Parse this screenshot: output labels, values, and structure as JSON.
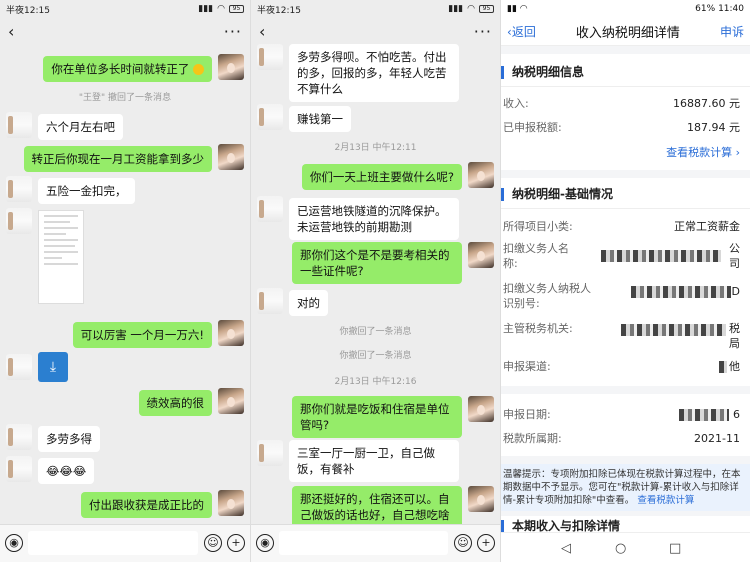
{
  "panels": {
    "left": {
      "status_time": "半夜12:15",
      "status_icons": "⏰",
      "battery": "95",
      "messages": [
        {
          "id": "m1",
          "text": "你在单位多长时间就转正了"
        },
        {
          "id": "s1",
          "text": "\"王登\" 撤回了一条消息"
        },
        {
          "id": "m2",
          "text": "六个月左右吧"
        },
        {
          "id": "m3",
          "text": "转正后你现在一月工资能拿到多少"
        },
        {
          "id": "m4",
          "text": "五险一金扣完，"
        },
        {
          "id": "m5",
          "text": "可以厉害 一个月一万六!"
        },
        {
          "id": "m6",
          "text": "绩效高的很"
        },
        {
          "id": "m7",
          "text": "多劳多得"
        },
        {
          "id": "m8",
          "text": "😂😂😂"
        },
        {
          "id": "m9",
          "text": "付出跟收获是成正比的"
        }
      ]
    },
    "middle": {
      "status_time": "半夜12:15",
      "battery": "95",
      "messages": [
        {
          "id": "n1",
          "text": "多劳多得呗。不怕吃苦。付出的多，回报的多，年轻人吃苦不算什么"
        },
        {
          "id": "n2",
          "text": "赚钱第一"
        },
        {
          "id": "t1",
          "text": "2月13日 中午12:11"
        },
        {
          "id": "n3",
          "text": "你们一天上班主要做什么呢?"
        },
        {
          "id": "n4",
          "text": "已运营地铁隧道的沉降保护。未运营地铁的前期勘测"
        },
        {
          "id": "n5",
          "text": "那你们这个是不是要考相关的一些证件呢?"
        },
        {
          "id": "n6",
          "text": "对的"
        },
        {
          "id": "s1",
          "text": "你撤回了一条消息"
        },
        {
          "id": "s2",
          "text": "你撤回了一条消息"
        },
        {
          "id": "t2",
          "text": "2月13日 中午12:16"
        },
        {
          "id": "n7",
          "text": "那你们就是吃饭和住宿是单位管吗?"
        },
        {
          "id": "n8",
          "text": "三室一厅一厨一卫，自己做饭，有餐补"
        },
        {
          "id": "n9",
          "text": "那还挺好的，住宿还可以。自己做饭的话也好，自己想吃啥做啥"
        }
      ]
    },
    "right": {
      "status_time": "11:40",
      "status_battery": "61%",
      "header": {
        "back": "返回",
        "title": "收入纳税明细详情",
        "complain": "申诉"
      },
      "section1": {
        "title": "纳税明细信息",
        "income_label": "收入:",
        "income_value": "16887.60 元",
        "tax_label": "已申报税额:",
        "tax_value": "187.94 元",
        "link": "查看税款计算"
      },
      "section2": {
        "title": "纳税明细-基础情况",
        "rows": [
          {
            "label": "所得项目小类:",
            "value": "正常工资薪金"
          },
          {
            "label": "扣缴义务人名称:",
            "value": "公司"
          },
          {
            "label": "扣缴义务人纳税人识别号:",
            "value": "D"
          },
          {
            "label": "主管税务机关:",
            "value": "税局"
          },
          {
            "label": "申报渠道:",
            "value": "他"
          },
          {
            "label": "申报日期:",
            "value": "6"
          },
          {
            "label": "税款所属期:",
            "value": "2021-11"
          }
        ],
        "tip_text": "温馨提示：专项附加扣除已体现在税款计算过程中，在本期数据中不予显示。您可在\"税款计算-累计收入与扣除详情-累计专项附加扣除\"中查看。",
        "tip_link": "查看税款计算"
      },
      "section3": {
        "title": "本期收入与扣除详情"
      }
    }
  }
}
